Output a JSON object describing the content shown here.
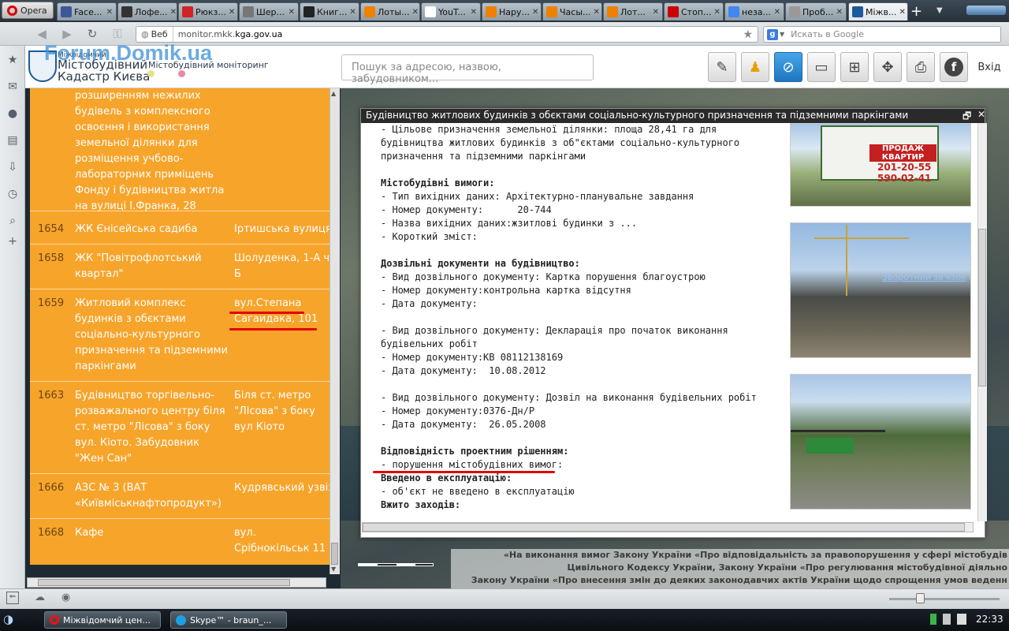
{
  "browser": {
    "menu_label": "Opera",
    "tabs": [
      {
        "title": "Face...",
        "icon": "facebook-icon",
        "color": "#3b5998"
      },
      {
        "title": "Лофе...",
        "icon": "page-icon",
        "color": "#333333"
      },
      {
        "title": "Рюкз...",
        "icon": "rp-icon",
        "color": "#d12323"
      },
      {
        "title": "Шер...",
        "icon": "ex-icon",
        "color": "#777777"
      },
      {
        "title": "Книг...",
        "icon": "e-icon",
        "color": "#222222"
      },
      {
        "title": "Лоты...",
        "icon": "auction-icon",
        "color": "#f08000"
      },
      {
        "title": "YouT...",
        "icon": "doc-icon",
        "color": "#ffffff"
      },
      {
        "title": "Нару...",
        "icon": "auction-icon",
        "color": "#f08000"
      },
      {
        "title": "Часы...",
        "icon": "auction-icon",
        "color": "#f08000"
      },
      {
        "title": "Лот...",
        "icon": "auction-icon",
        "color": "#f08000"
      },
      {
        "title": "Стоп...",
        "icon": "youtube-icon",
        "color": "#cc0000"
      },
      {
        "title": "неза...",
        "icon": "google-icon",
        "color": "#4285f4"
      },
      {
        "title": "Проб...",
        "icon": "loading-icon",
        "color": "#999999"
      },
      {
        "title": "Міжв...",
        "icon": "kiev-icon",
        "color": "#1d5a9c",
        "active": true
      }
    ],
    "web_badge": "Веб",
    "url_prefix": "monitor.mkk.",
    "url_domain": "kga.gov.ua",
    "search_placeholder": "Искать в Google",
    "search_engine_label": "g"
  },
  "site": {
    "watermark": "Forum.Domik.ua",
    "logo_line1": "Міжвідомчий",
    "logo_line2": "Містобудівний",
    "logo_line3": "Кадастр Києва",
    "subtitle": "Містобудівний моніторинг",
    "search_placeholder": "Пошук за адресою, назвою, забудовником...",
    "login_label": "Вхід",
    "toolbar_icons": [
      "edit-icon",
      "pegman-icon",
      "compass-icon",
      "ruler-icon",
      "layers-icon",
      "move-icon",
      "print-icon",
      "facebook-icon"
    ]
  },
  "list": {
    "rows": [
      {
        "num": "",
        "name": "розширенням нежилих будівель з комплексного освоєння і використання земельної ділянки для розміщення учбово-лабораторних приміщень Фонду і будівництва житла на вулиці І.Франка, 28",
        "addr": ""
      },
      {
        "num": "1654",
        "name": "ЖК Єнісейська садиба",
        "addr": "Іртишська вулиця"
      },
      {
        "num": "1658",
        "name": "ЖК \"Повітрофлотський квартал\"",
        "addr": "Шолуденка, 1-А ч Б"
      },
      {
        "num": "1659",
        "name": "Житловий комплекс будинків з обєктами соціально-культурного призначення та підземними паркінгами",
        "addr": "вул.Степана Сагаидака, 101"
      },
      {
        "num": "1663",
        "name": "Будівництво торгівельно-розважального центру біля ст. метро \"Лісова\" з боку вул. Кіото. Забудовник \"Жен Сан\"",
        "addr": "Біля ст. метро \"Лісова\" з боку вул Кіото"
      },
      {
        "num": "1666",
        "name": "АЗС № 3 (ВАТ «Київміськнафтопродукт»)",
        "addr": "Кудрявський узвіз"
      },
      {
        "num": "1668",
        "name": "Кафе",
        "addr": "вул. Срібнокільськ 11"
      }
    ]
  },
  "popup": {
    "title": "Будівництво житлових будинків з обєктами соціально-культурного призначення та підземними паркінгами",
    "lines": [
      {
        "t": "- Цільове призначення земельної ділянки: площа 28,41 га для",
        "b": false
      },
      {
        "t": "будівництва житлових будинків з об\"єктами соціально-культурного",
        "b": false
      },
      {
        "t": "призначення та підземними паркінгами",
        "b": false
      },
      {
        "t": "",
        "b": false
      },
      {
        "t": "Містобудівні вимоги:",
        "b": true
      },
      {
        "t": "- Тип вихідних даних: Архітектурно-планувальне завдання",
        "b": false
      },
      {
        "t": "- Номер документу:      20-744",
        "b": false
      },
      {
        "t": "- Назва вихідних даних:жзитлові будинки з ...",
        "b": false
      },
      {
        "t": "- Короткий зміст:",
        "b": false
      },
      {
        "t": "",
        "b": false
      },
      {
        "t": "Дозвільні документи на будівництво:",
        "b": true
      },
      {
        "t": "- Вид дозвільного документу: Картка порушення благоустрою",
        "b": false
      },
      {
        "t": "- Номер документу:контрольна картка відсутня",
        "b": false
      },
      {
        "t": "- Дата документу:",
        "b": false
      },
      {
        "t": "",
        "b": false
      },
      {
        "t": "- Вид дозвільного документу: Декларація про початок виконання",
        "b": false
      },
      {
        "t": "будівельних робіт",
        "b": false
      },
      {
        "t": "- Номер документу:КВ 08112138169",
        "b": false
      },
      {
        "t": "- Дата документу:  10.08.2012",
        "b": false
      },
      {
        "t": "",
        "b": false
      },
      {
        "t": "- Вид дозвільного документу: Дозвіл на виконання будівельних робіт",
        "b": false
      },
      {
        "t": "- Номер документу:0376-Дн/Р",
        "b": false
      },
      {
        "t": "- Дата документу:  26.05.2008",
        "b": false
      },
      {
        "t": "",
        "b": false
      },
      {
        "t": "Відповідність проектним рішенням:",
        "b": true
      },
      {
        "t": "- порушення містобудівних вимог:",
        "b": false
      },
      {
        "t": "Введено в експлуатацію:",
        "b": true
      },
      {
        "t": "- об'єкт не введено в експлуатацію",
        "b": false
      },
      {
        "t": "Вжито заходів:",
        "b": true
      }
    ],
    "billboard": {
      "line1": "ПРОДАЖ КВАРТИР",
      "line2": "201-20-55",
      "line3": "590-02-41"
    },
    "feedback_link": "Зворотний зв'язок"
  },
  "map": {
    "law_line1": "«На виконання вимог Закону України «Про відповідальність за правопорушення у сфері містобудів",
    "law_line2": "Цивільного Кодексу України, Закону України «Про регулювання містобудівної діяльно",
    "law_line3": "Закону України «Про внесення змін до деяких законодавчих актів України щодо спрощення умов веденн"
  },
  "taskbar": {
    "tasks": [
      {
        "label": "Міжвідомчий цен...",
        "icon": "opera-icon"
      },
      {
        "label": "Skype™ - braun_...",
        "icon": "skype-icon"
      }
    ],
    "clock": "22:33"
  }
}
